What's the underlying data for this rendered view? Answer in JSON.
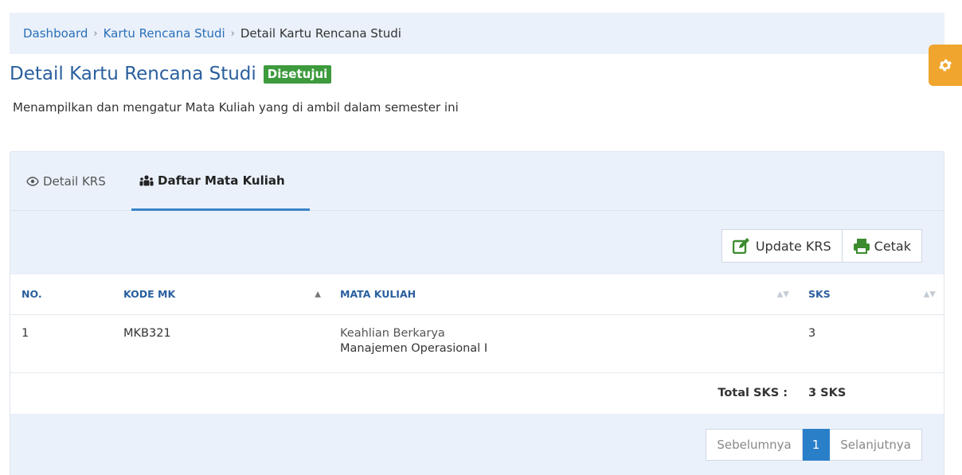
{
  "breadcrumb": {
    "items": [
      "Dashboard",
      "Kartu Rencana Studi"
    ],
    "current": "Detail Kartu Rencana Studi",
    "separator": "›"
  },
  "header": {
    "title": "Detail Kartu Rencana Studi",
    "status": "Disetujui",
    "description": "Menampilkan dan mengatur Mata Kuliah yang di ambil dalam semester ini"
  },
  "settings": {
    "icon": "gear-icon",
    "color": "#f0a52e"
  },
  "tabs": [
    {
      "label": "Detail KRS",
      "icon": "eye-icon",
      "active": false
    },
    {
      "label": "Daftar Mata Kuliah",
      "icon": "users-icon",
      "active": true
    }
  ],
  "toolbar": {
    "update_label": "Update KRS",
    "print_label": "Cetak"
  },
  "table": {
    "columns": [
      "NO.",
      "KODE MK",
      "MATA KULIAH",
      "SKS"
    ],
    "rows": [
      {
        "no": "1",
        "kode": "MKB321",
        "group": "Keahlian Berkarya",
        "name": "Manajemen Operasional I",
        "sks": "3"
      }
    ],
    "total_label": "Total SKS :",
    "total_value": "3 SKS"
  },
  "pagination": {
    "prev": "Sebelumnya",
    "current": "1",
    "next": "Selanjutnya"
  },
  "colors": {
    "accent": "#2a7fc9",
    "badge": "#3d9a3d",
    "edit_icon": "#3d8b2f",
    "print_icon": "#3d8b2f"
  }
}
